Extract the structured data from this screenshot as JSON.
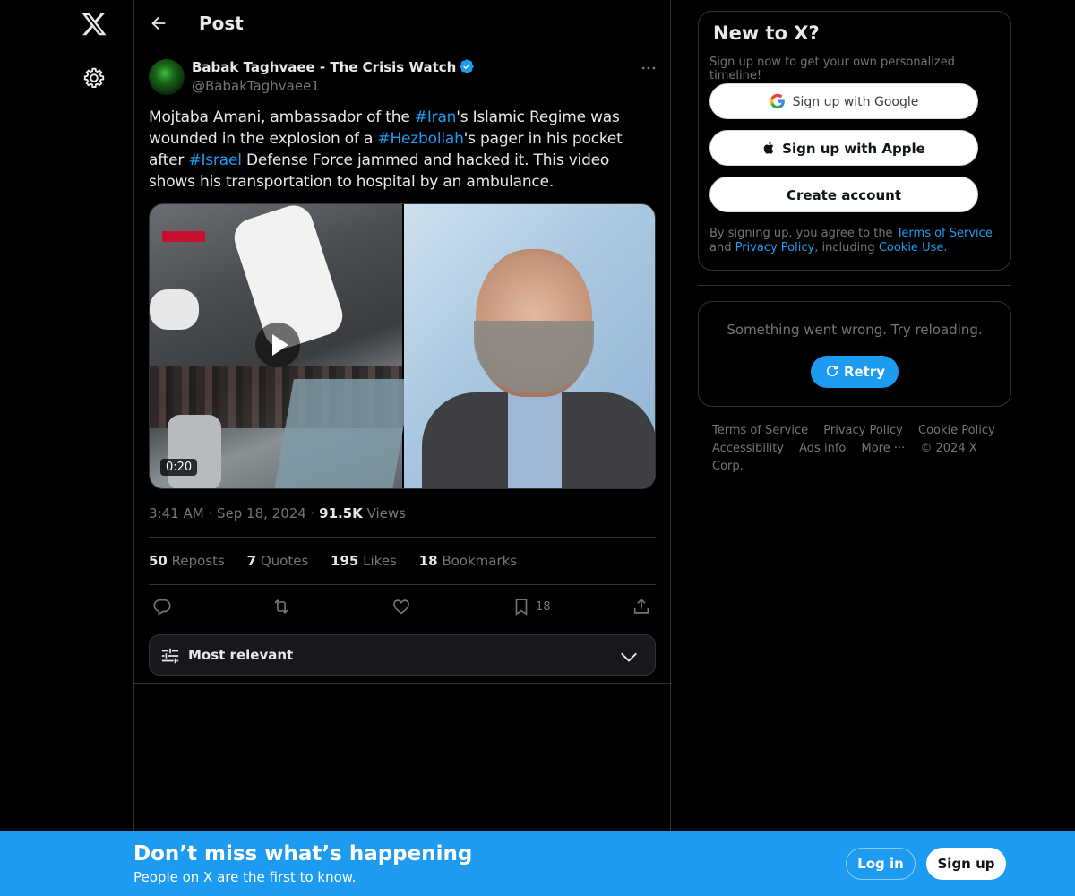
{
  "header": {
    "title": "Post"
  },
  "post": {
    "author_name": "Babak Taghvaee - The Crisis Watch",
    "author_handle": "@BabakTaghvaee1",
    "text_segments": [
      {
        "t": "Mojtaba Amani, ambassador of the ",
        "tag": false
      },
      {
        "t": "#Iran",
        "tag": true
      },
      {
        "t": "'s Islamic Regime was wounded in the explosion of a ",
        "tag": false
      },
      {
        "t": "#Hezbollah",
        "tag": true
      },
      {
        "t": "'s pager in his pocket after ",
        "tag": false
      },
      {
        "t": "#Israel",
        "tag": true
      },
      {
        "t": " Defense Force jammed and hacked it. This video shows his transportation to hospital by an ambulance.",
        "tag": false
      }
    ],
    "video_duration": "0:20",
    "time": "3:41 AM",
    "date": "Sep 18, 2024",
    "views_count": "91.5K",
    "views_label": "Views",
    "stats": {
      "reposts_count": "50",
      "reposts_label": "Reposts",
      "quotes_count": "7",
      "quotes_label": "Quotes",
      "likes_count": "195",
      "likes_label": "Likes",
      "bookmarks_count": "18",
      "bookmarks_label": "Bookmarks"
    },
    "bookmark_action_count": "18",
    "sort_label": "Most relevant"
  },
  "signup": {
    "title": "New to X?",
    "subtitle": "Sign up now to get your own personalized timeline!",
    "google_label": "Sign up with Google",
    "apple_label": "Sign up with Apple",
    "create_label": "Create account",
    "terms_pre": "By signing up, you agree to the ",
    "terms_tos": "Terms of Service",
    "terms_and": " and ",
    "terms_privacy": "Privacy Policy",
    "terms_including": ", including ",
    "terms_cookie": "Cookie Use."
  },
  "error": {
    "text": "Something went wrong. Try reloading.",
    "retry_label": "Retry"
  },
  "footer": {
    "terms": "Terms of Service",
    "privacy": "Privacy Policy",
    "cookie": "Cookie Policy",
    "accessibility": "Accessibility",
    "ads": "Ads info",
    "more": "More ···",
    "copyright": "© 2024 X Corp."
  },
  "bottom": {
    "title": "Don’t miss what’s happening",
    "subtitle": "People on X are the first to know.",
    "login_label": "Log in",
    "signup_label": "Sign up"
  },
  "colors": {
    "accent": "#1d9bf0",
    "background": "#000000",
    "border": "#2f3336",
    "muted": "#71767b"
  }
}
